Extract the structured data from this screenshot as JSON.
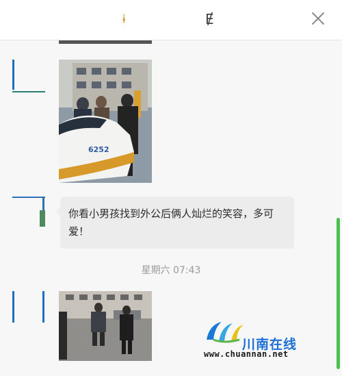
{
  "header": {
    "title_fragment_left": "ɨ",
    "title_fragment_right": "Ɇ",
    "close_icon": "close-icon"
  },
  "messages": [
    {
      "type": "image",
      "description_icon": "photo"
    },
    {
      "type": "text",
      "text": "你看小男孩找到外公后俩人灿烂的笑容，多可爱！"
    },
    {
      "type": "image",
      "description_icon": "photo"
    }
  ],
  "timestamp": "星期六 07:43",
  "watermark": {
    "brand": "川南在线",
    "url": "www.chuannan.net"
  },
  "colors": {
    "accent_scroll": "#4cbf4c",
    "bubble": "#ececec",
    "watermark_blue": "#1b6fd6"
  }
}
